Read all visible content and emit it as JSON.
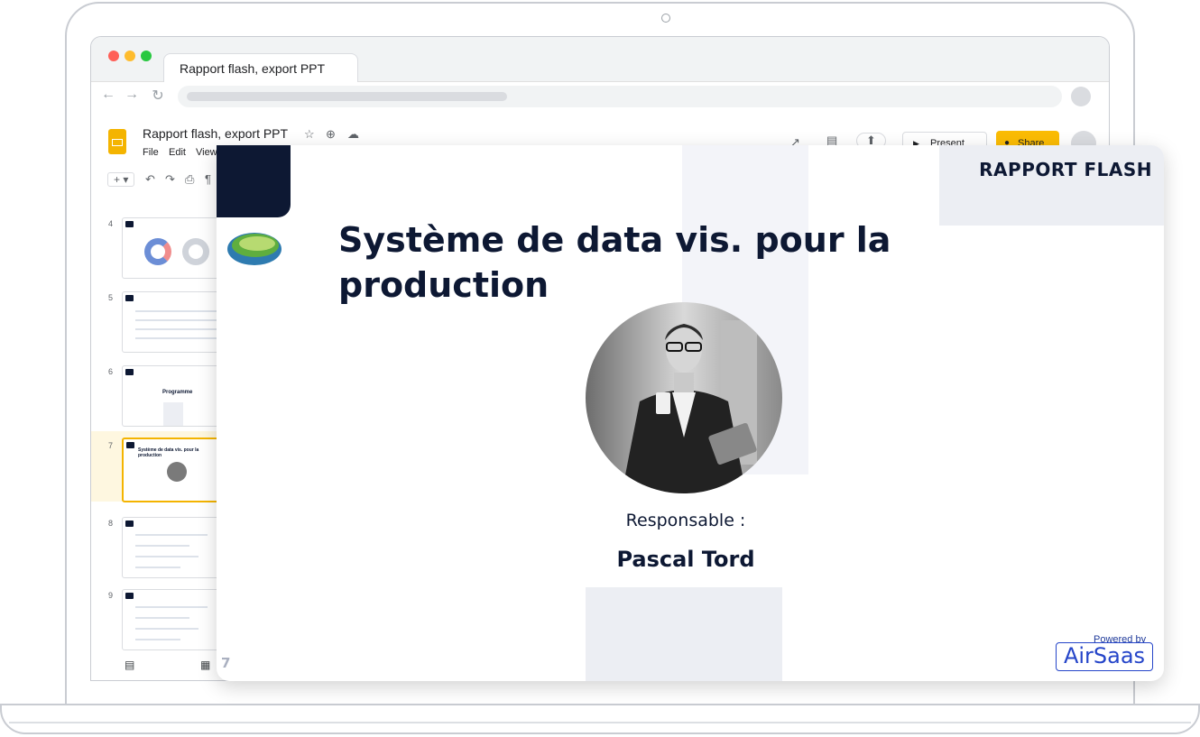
{
  "browser": {
    "tab_title": "Rapport flash, export PPT",
    "traffic_colors": [
      "#ff5f57",
      "#febc2e",
      "#28c840"
    ]
  },
  "app": {
    "doc_title": "Rapport flash, export PPT",
    "menus": [
      "File",
      "Edit",
      "View"
    ],
    "present_label": "Present",
    "share_label": "Share",
    "brand_color": "#f4b400"
  },
  "filmstrip": {
    "thumbs": [
      {
        "num": "4",
        "text": ""
      },
      {
        "num": "5",
        "text": ""
      },
      {
        "num": "6",
        "text": "Programme"
      },
      {
        "num": "7",
        "text": "Système de data vis. pour la production"
      },
      {
        "num": "8",
        "text": ""
      },
      {
        "num": "9",
        "text": ""
      }
    ],
    "selected_index": 3
  },
  "slide": {
    "label_top": "RAPPORT FLASH",
    "title": "Système de data vis. pour la production",
    "responsible_label": "Responsable :",
    "responsible_name": "Pascal Tord",
    "page_number": "7",
    "powered_by": "Powered by",
    "brand_logo": "AirSaas",
    "dark_color": "#0d1833",
    "brand_blue": "#2545c9"
  }
}
